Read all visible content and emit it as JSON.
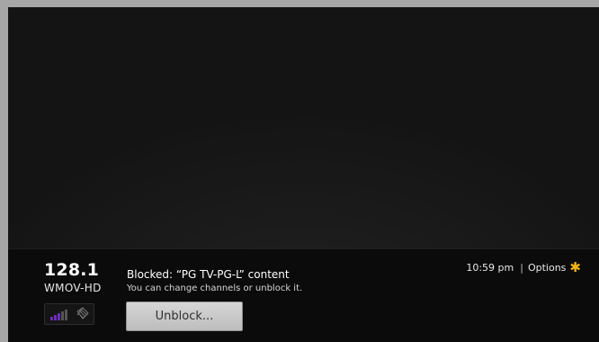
{
  "channel": {
    "number": "128.1",
    "name": "WMOV-HD",
    "signal_level": 0.6
  },
  "message": {
    "title": "Blocked: “PG TV-PG-L” content",
    "subtitle": "You can change channels or unblock it."
  },
  "button": {
    "label": "Unblock..."
  },
  "status": {
    "time": "10:59 pm",
    "separator": "|",
    "options_label": "Options",
    "options_icon": "asterisk-icon"
  },
  "colors": {
    "accent": "#f3b21a",
    "signal_active": "#6b2fb8",
    "signal_inactive": "#555555"
  }
}
